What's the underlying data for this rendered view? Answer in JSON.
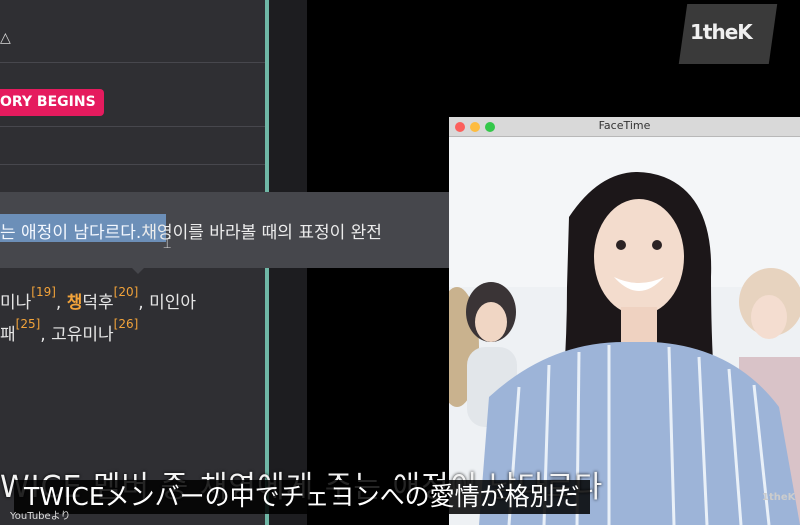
{
  "left_panel": {
    "expand_glyph": "△",
    "badge": "ORY BEGINS",
    "tooltip_selected": "는 애정이 남다르다.",
    "tooltip_rest": "채영이를 바라볼 때의 표정이 완전",
    "wiki_line1": {
      "a": "미나",
      "ref1": "[19]",
      "b": ", ",
      "c": "챙",
      "d": "덕후",
      "ref2": "[20]",
      "e": ", 미인아"
    },
    "wiki_line2": {
      "a": "패",
      "ref1": "[25]",
      "b": ", 고유미나",
      "ref2": "[26]"
    }
  },
  "logo": {
    "text": "1theK"
  },
  "facetime": {
    "title": "FaceTime",
    "corner_mark": "1theK"
  },
  "subtitles": {
    "korean": "WICE 멤버 중 채영에게 주는 애정이 남다르다",
    "japanese": "TWICEメンバーの中でチェヨンへの愛情が格別だ",
    "credit": "YouTubeより"
  }
}
